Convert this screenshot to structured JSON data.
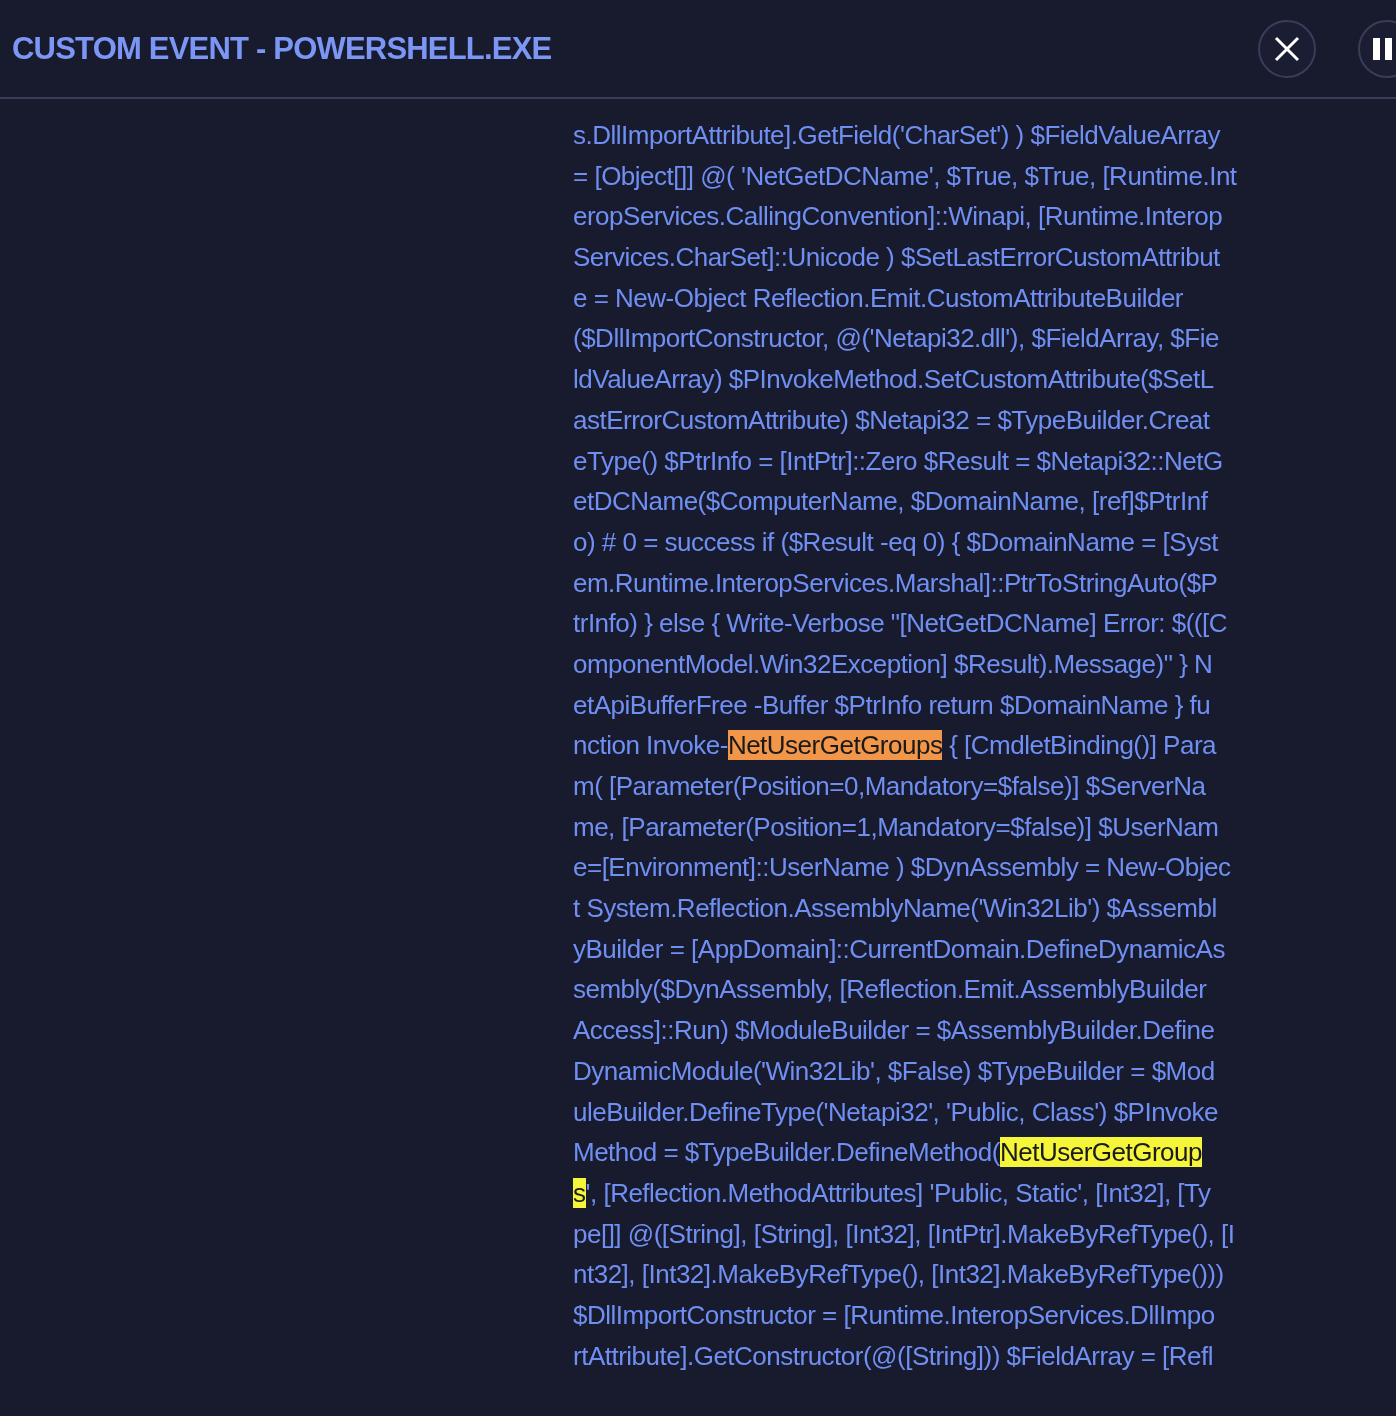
{
  "header": {
    "title": "CUSTOM EVENT - POWERSHELL.EXE"
  },
  "code_lines": [
    {
      "segments": [
        {
          "text": "s.DllImportAttribute].GetField('CharSet') ) $FieldValueArray",
          "highlighted": false
        }
      ]
    },
    {
      "segments": [
        {
          "text": "= [Object[]] @( 'NetGetDCName', $True, $True, [Runtime.Int",
          "highlighted": false
        }
      ]
    },
    {
      "segments": [
        {
          "text": "eropServices.CallingConvention]::Winapi, [Runtime.Interop",
          "highlighted": false
        }
      ]
    },
    {
      "segments": [
        {
          "text": "Services.CharSet]::Unicode ) $SetLastErrorCustomAttribut",
          "highlighted": false
        }
      ]
    },
    {
      "segments": [
        {
          "text": "e = New-Object Reflection.Emit.CustomAttributeBuilder",
          "highlighted": false
        }
      ]
    },
    {
      "segments": [
        {
          "text": "($DllImportConstructor, @('Netapi32.dll'), $FieldArray, $Fie",
          "highlighted": false
        }
      ]
    },
    {
      "segments": [
        {
          "text": "ldValueArray) $PInvokeMethod.SetCustomAttribute($SetL",
          "highlighted": false
        }
      ]
    },
    {
      "segments": [
        {
          "text": "astErrorCustomAttribute) $Netapi32 = $TypeBuilder.Creat",
          "highlighted": false
        }
      ]
    },
    {
      "segments": [
        {
          "text": "eType() $PtrInfo = [IntPtr]::Zero $Result = $Netapi32::NetG",
          "highlighted": false
        }
      ]
    },
    {
      "segments": [
        {
          "text": "etDCName($ComputerName, $DomainName, [ref]$PtrInf",
          "highlighted": false
        }
      ]
    },
    {
      "segments": [
        {
          "text": "o) # 0 = success if ($Result -eq 0) { $DomainName = [Syst",
          "highlighted": false
        }
      ]
    },
    {
      "segments": [
        {
          "text": "em.Runtime.InteropServices.Marshal]::PtrToStringAuto($P",
          "highlighted": false
        }
      ]
    },
    {
      "segments": [
        {
          "text": "trInfo) } else { Write-Verbose \"[NetGetDCName] Error: $(([C",
          "highlighted": false
        }
      ]
    },
    {
      "segments": [
        {
          "text": "omponentModel.Win32Exception] $Result).Message)\" } N",
          "highlighted": false
        }
      ]
    },
    {
      "segments": [
        {
          "text": "etApiBufferFree -Buffer $PtrInfo return $DomainName } fu",
          "highlighted": false
        }
      ]
    },
    {
      "segments": [
        {
          "text": "nction Invoke-",
          "highlighted": false
        },
        {
          "text": "NetUserGetGroups",
          "highlighted": true,
          "current": true
        },
        {
          "text": " { [CmdletBinding()] Para",
          "highlighted": false
        }
      ]
    },
    {
      "segments": [
        {
          "text": "m( [Parameter(Position=0,Mandatory=$false)] $ServerNa",
          "highlighted": false
        }
      ]
    },
    {
      "segments": [
        {
          "text": "me, [Parameter(Position=1,Mandatory=$false)] $UserNam",
          "highlighted": false
        }
      ]
    },
    {
      "segments": [
        {
          "text": "e=[Environment]::UserName ) $DynAssembly = New-Objec",
          "highlighted": false
        }
      ]
    },
    {
      "segments": [
        {
          "text": "t System.Reflection.AssemblyName('Win32Lib') $Assembl",
          "highlighted": false
        }
      ]
    },
    {
      "segments": [
        {
          "text": "yBuilder = [AppDomain]::CurrentDomain.DefineDynamicAs",
          "highlighted": false
        }
      ]
    },
    {
      "segments": [
        {
          "text": "sembly($DynAssembly, [Reflection.Emit.AssemblyBuilder",
          "highlighted": false
        }
      ]
    },
    {
      "segments": [
        {
          "text": "Access]::Run) $ModuleBuilder = $AssemblyBuilder.Define",
          "highlighted": false
        }
      ]
    },
    {
      "segments": [
        {
          "text": "DynamicModule('Win32Lib', $False) $TypeBuilder = $Mod",
          "highlighted": false
        }
      ]
    },
    {
      "segments": [
        {
          "text": "uleBuilder.DefineType('Netapi32', 'Public, Class') $PInvoke",
          "highlighted": false
        }
      ]
    },
    {
      "segments": [
        {
          "text": "Method = $TypeBuilder.DefineMethod(",
          "highlighted": false
        },
        {
          "text": "NetUserGetGroup",
          "highlighted": true,
          "current": false
        }
      ]
    },
    {
      "segments": [
        {
          "text": "s",
          "highlighted": true,
          "current": false
        },
        {
          "text": "', [Reflection.MethodAttributes] 'Public, Static', [Int32], [Ty",
          "highlighted": false
        }
      ]
    },
    {
      "segments": [
        {
          "text": "pe[]] @([String], [String], [Int32], [IntPtr].MakeByRefType(), [I",
          "highlighted": false
        }
      ]
    },
    {
      "segments": [
        {
          "text": "nt32], [Int32].MakeByRefType(), [Int32].MakeByRefType()))",
          "highlighted": false
        }
      ]
    },
    {
      "segments": [
        {
          "text": "$DllImportConstructor = [Runtime.InteropServices.DllImpo",
          "highlighted": false
        }
      ]
    },
    {
      "segments": [
        {
          "text": "rtAttribute].GetConstructor(@([String])) $FieldArray = [Refl",
          "highlighted": false
        }
      ]
    }
  ]
}
